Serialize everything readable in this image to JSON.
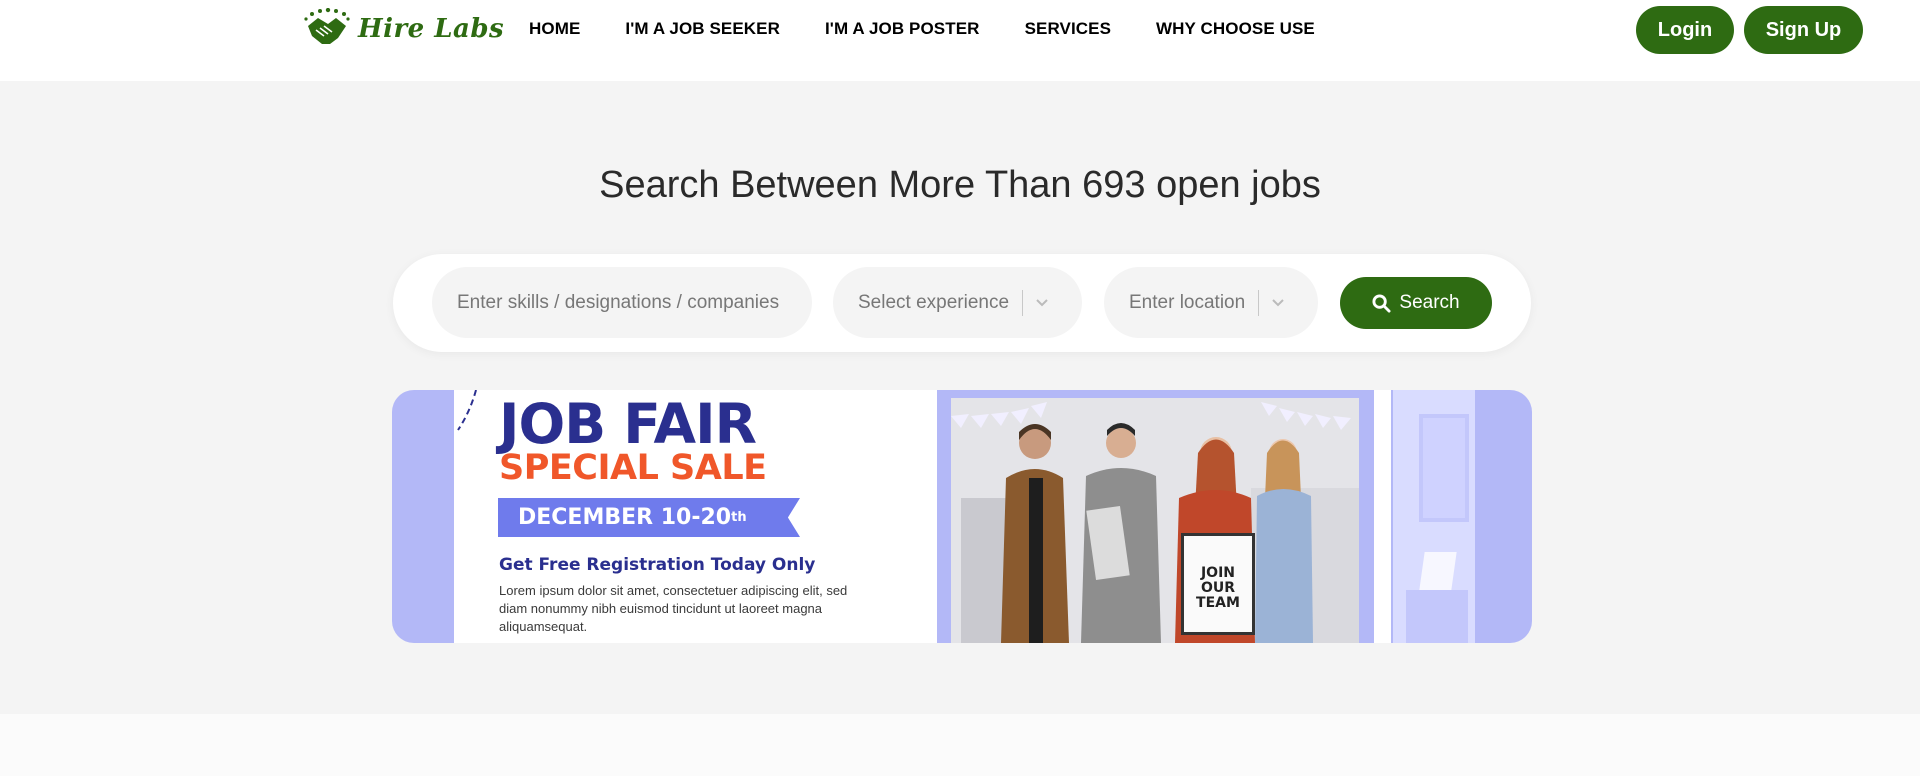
{
  "brand": {
    "name": "Hire Labs",
    "logo_icon": "handshake-icon",
    "color": "#2e6b12"
  },
  "nav": {
    "items": [
      "HOME",
      "I'M A JOB SEEKER",
      "I'M A JOB POSTER",
      "SERVICES",
      "WHY CHOOSE USE"
    ]
  },
  "auth": {
    "login": "Login",
    "signup": "Sign Up"
  },
  "hero": {
    "title": "Search Between More Than 693 open jobs"
  },
  "search": {
    "skills_placeholder": "Enter skills / designations / companies",
    "experience_placeholder": "Select experience",
    "location_placeholder": "Enter location",
    "button": "Search",
    "button_icon": "search-icon"
  },
  "banner": {
    "title": "JOB FAIR",
    "subtitle": "SPECIAL SALE",
    "date": "DECEMBER 10-20",
    "date_suffix": "th",
    "registration": "Get Free Registration Today Only",
    "lorem": "Lorem ipsum dolor sit amet, consectetuer adipiscing elit, sed diam nonummy nibh euismod tincidunt ut laoreet magna aliquamsequat.",
    "sign_text": [
      "JOIN",
      "OUR",
      "TEAM"
    ]
  }
}
